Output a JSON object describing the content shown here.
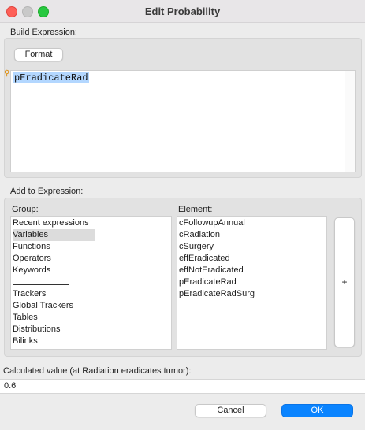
{
  "window": {
    "title": "Edit Probability"
  },
  "build": {
    "label": "Build Expression:",
    "format_label": "Format",
    "expression": "pEradicateRad"
  },
  "add": {
    "label": "Add to Expression:"
  },
  "group": {
    "label": "Group:",
    "items": [
      "Recent expressions",
      "Variables",
      "Functions",
      "Operators",
      "Keywords",
      "Trackers",
      "Global Trackers",
      "Tables",
      "Distributions",
      "Bilinks"
    ],
    "selected": "Variables"
  },
  "element": {
    "label": "Element:",
    "items": [
      "cFollowupAnnual",
      "cRadiation",
      "cSurgery",
      "effEradicated",
      "effNotEradicated",
      "pEradicateRad",
      "pEradicateRadSurg"
    ]
  },
  "insert_label": "+",
  "calc": {
    "label": "Calculated value (at Radiation eradicates tumor):",
    "value": "0.6"
  },
  "footer": {
    "cancel_label": "Cancel",
    "ok_label": "OK"
  }
}
